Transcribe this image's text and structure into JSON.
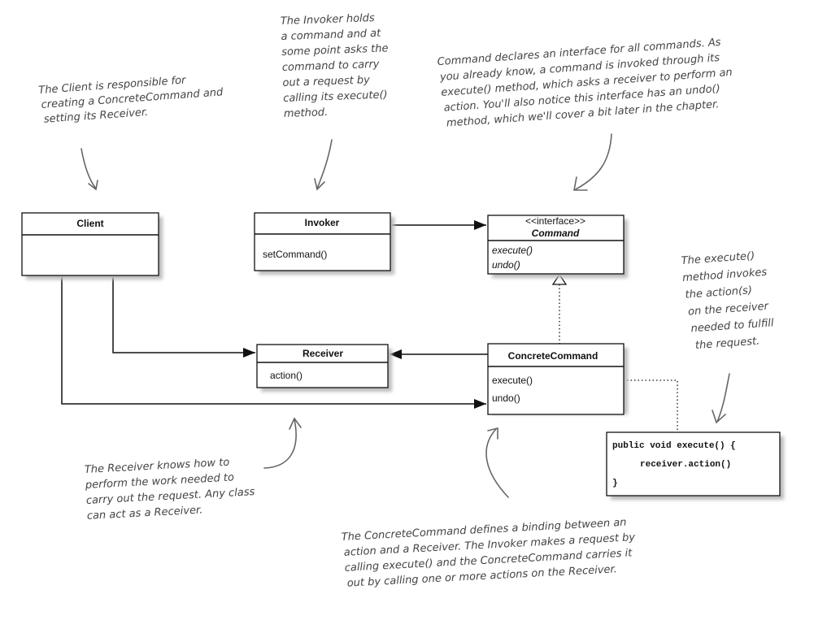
{
  "classes": {
    "client": {
      "name": "Client"
    },
    "invoker": {
      "name": "Invoker",
      "methods": [
        "setCommand()"
      ]
    },
    "command": {
      "stereotype": "<<interface>>",
      "name": "Command",
      "methods": [
        "execute()",
        "undo()"
      ]
    },
    "receiver": {
      "name": "Receiver",
      "methods": [
        "action()"
      ]
    },
    "concrete_command": {
      "name": "ConcreteCommand",
      "methods": [
        "execute()",
        "undo()"
      ]
    }
  },
  "code": [
    "public void execute() {",
    "receiver.action()",
    "}"
  ],
  "annotations": {
    "client": [
      "The Client is responsible for",
      "creating a ConcreteCommand and",
      "setting its Receiver."
    ],
    "invoker": [
      "The Invoker holds",
      "a command and at",
      "some point asks the",
      "command to carry",
      "out a request by",
      "calling its execute()",
      "method."
    ],
    "command": [
      "Command declares an interface for all commands. As",
      "you already know, a command is invoked through its",
      "execute() method, which asks a receiver to perform an",
      "action. You'll also notice this interface has an undo()",
      "method, which we'll cover a bit later in the chapter."
    ],
    "execute": [
      "The execute()",
      "method invokes",
      "the action(s)",
      "on the receiver",
      "needed to fulfill",
      "the request."
    ],
    "receiver": [
      "The Receiver knows how to",
      "perform the work needed to",
      "carry out the request. Any class",
      "can act as a Receiver."
    ],
    "concrete_command": [
      "The ConcreteCommand defines a binding between an",
      "action and a Receiver. The Invoker makes a request by",
      "calling execute() and the ConcreteCommand carries it",
      "out by calling one or more actions on the Receiver."
    ]
  }
}
